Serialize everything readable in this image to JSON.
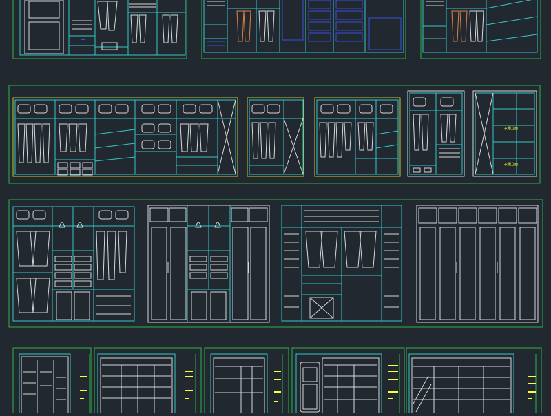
{
  "colors": {
    "background": "#212830",
    "frame": "#2fb34a",
    "cabinet": "#35c8c8",
    "detail": "#d8d8d8",
    "blue": "#3a4fd8",
    "accent": "#e08040",
    "label": "#ffff33"
  },
  "rows": {
    "row1": {
      "frames": 3
    },
    "row2": {
      "frames": 1,
      "sub_elevations": 5
    },
    "row3": {
      "frames": 1,
      "sub_elevations": 4
    },
    "row4": {
      "frames": 5
    }
  },
  "annotations": {
    "row2_label_a": "衣柜立面",
    "row2_label_b": "衣柜立面"
  }
}
